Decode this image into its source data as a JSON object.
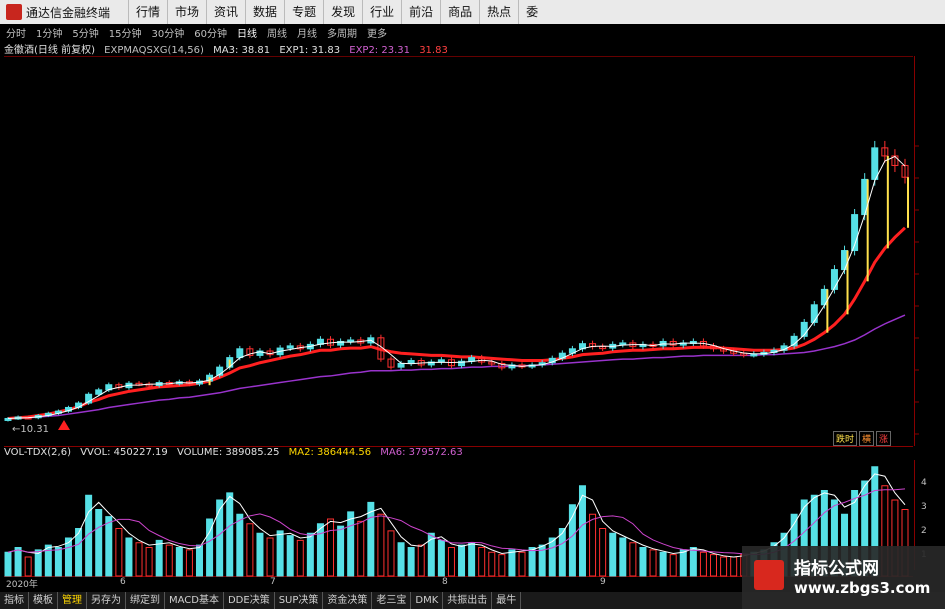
{
  "app": {
    "title": "通达信金融终端",
    "menu": [
      "行情",
      "市场",
      "资讯",
      "数据",
      "专题",
      "发现",
      "行业",
      "前沿",
      "商品",
      "热点",
      "委"
    ]
  },
  "period_tabs": [
    "分时",
    "1分钟",
    "5分钟",
    "15分钟",
    "30分钟",
    "60分钟",
    "日线",
    "周线",
    "月线",
    "多周期",
    "更多"
  ],
  "active_period": "日线",
  "stock": {
    "name": "金徽酒(日线 前复权)",
    "indicator_name": "EXPMAQSXG(14,56)",
    "ma3": "MA3: 38.81",
    "exp1": "EXP1: 31.83",
    "exp2": "EXP2: 23.31",
    "exp3": "31.83"
  },
  "low_marker": "10.31",
  "volume": {
    "indicator": "VOL-TDX(2,6)",
    "vvol": "VVOL: 450227.19",
    "volume": "VOLUME: 389085.25",
    "ma2": "MA2: 386444.56",
    "ma6": "MA6: 379572.63"
  },
  "vol_axis_ticks": [
    "4",
    "3",
    "2",
    "1"
  ],
  "xaxis": {
    "year": "2020年",
    "months": [
      "6",
      "7",
      "8",
      "9"
    ]
  },
  "legend": [
    "跌时",
    "横",
    "涨"
  ],
  "bottom_tabs": [
    "指标",
    "模板",
    "管理",
    "另存为",
    "绑定到",
    "MACD基本",
    "DDE决策",
    "SUP决策",
    "资金决策",
    "老三宝",
    "DMK",
    "共振出击",
    "最牛"
  ],
  "active_bottom_tab": "管理",
  "watermark": {
    "title": "指标公式网",
    "url": "www.zbgs3.com"
  },
  "colors": {
    "up": "#56e0e6",
    "down": "#ff3030",
    "ma": "#ffffff",
    "exp1": "#ff2020",
    "exp2": "#9933cc",
    "signal": "#ffe14d"
  },
  "chart_data": {
    "type": "candlestick",
    "price_series": {
      "close": [
        10.3,
        10.5,
        10.4,
        10.7,
        11.0,
        11.3,
        11.8,
        12.4,
        13.6,
        14.2,
        14.9,
        14.5,
        15.1,
        15.0,
        14.8,
        15.2,
        15.1,
        15.3,
        15.0,
        15.4,
        16.2,
        17.3,
        18.6,
        19.8,
        18.9,
        19.5,
        19.0,
        19.9,
        20.2,
        19.8,
        20.4,
        21.1,
        20.3,
        20.8,
        21.0,
        20.6,
        21.3,
        18.4,
        17.3,
        17.8,
        18.2,
        17.6,
        18.0,
        18.3,
        17.5,
        18.1,
        18.6,
        18.0,
        17.8,
        17.2,
        17.6,
        17.4,
        17.6,
        17.9,
        18.5,
        19.2,
        19.8,
        20.5,
        20.1,
        19.9,
        20.4,
        20.6,
        20.1,
        20.4,
        20.2,
        20.8,
        20.3,
        20.6,
        20.8,
        20.2,
        19.8,
        19.5,
        19.2,
        19.0,
        19.1,
        19.3,
        19.6,
        20.2,
        21.5,
        23.4,
        25.8,
        27.9,
        30.6,
        33.2,
        38.1,
        42.9,
        47.2,
        46.1,
        44.8,
        43.2
      ],
      "exp1": [
        10.3,
        10.4,
        10.5,
        10.7,
        10.9,
        11.2,
        11.5,
        11.9,
        12.5,
        12.9,
        13.4,
        13.7,
        14.0,
        14.2,
        14.4,
        14.6,
        14.7,
        14.8,
        14.9,
        15.1,
        15.4,
        15.9,
        16.5,
        17.2,
        17.5,
        17.9,
        18.2,
        18.5,
        18.8,
        19.0,
        19.3,
        19.6,
        19.6,
        19.8,
        19.9,
        19.9,
        20.1,
        19.7,
        19.4,
        19.2,
        19.1,
        19.0,
        18.9,
        18.9,
        18.8,
        18.7,
        18.7,
        18.6,
        18.5,
        18.4,
        18.3,
        18.2,
        18.2,
        18.2,
        18.3,
        18.5,
        18.7,
        19.0,
        19.1,
        19.2,
        19.4,
        19.5,
        19.6,
        19.6,
        19.7,
        19.8,
        19.8,
        19.9,
        20.0,
        20.0,
        20.0,
        19.9,
        19.8,
        19.7,
        19.6,
        19.6,
        19.6,
        19.7,
        19.9,
        20.4,
        21.1,
        22.0,
        23.1,
        24.5,
        26.6,
        29.0,
        31.6,
        33.5,
        35.0,
        36.3
      ],
      "exp2": [
        10.3,
        10.35,
        10.4,
        10.5,
        10.6,
        10.7,
        10.9,
        11.1,
        11.3,
        11.5,
        11.8,
        12.0,
        12.2,
        12.4,
        12.6,
        12.8,
        12.9,
        13.1,
        13.2,
        13.4,
        13.6,
        13.8,
        14.1,
        14.4,
        14.6,
        14.8,
        15.0,
        15.2,
        15.4,
        15.6,
        15.8,
        16.0,
        16.1,
        16.3,
        16.5,
        16.6,
        16.8,
        16.8,
        16.8,
        16.9,
        16.9,
        17.0,
        17.0,
        17.1,
        17.1,
        17.2,
        17.3,
        17.3,
        17.4,
        17.4,
        17.4,
        17.5,
        17.5,
        17.6,
        17.7,
        17.8,
        17.9,
        18.0,
        18.1,
        18.2,
        18.3,
        18.4,
        18.4,
        18.5,
        18.6,
        18.6,
        18.7,
        18.8,
        18.8,
        18.9,
        18.9,
        18.9,
        18.9,
        18.9,
        18.9,
        19.0,
        19.0,
        19.1,
        19.2,
        19.3,
        19.5,
        19.8,
        20.1,
        20.5,
        21.0,
        21.7,
        22.5,
        23.2,
        23.8,
        24.4
      ]
    },
    "volume_series": [
      1.0,
      1.2,
      0.8,
      1.1,
      1.3,
      1.2,
      1.6,
      2.0,
      3.4,
      2.8,
      2.5,
      2.0,
      1.6,
      1.4,
      1.2,
      1.5,
      1.3,
      1.2,
      1.1,
      1.3,
      2.4,
      3.2,
      3.5,
      2.6,
      2.2,
      1.8,
      1.6,
      1.9,
      1.7,
      1.5,
      1.8,
      2.2,
      2.4,
      2.1,
      2.7,
      2.3,
      3.1,
      2.6,
      1.9,
      1.4,
      1.2,
      1.3,
      1.8,
      1.5,
      1.2,
      1.3,
      1.4,
      1.2,
      1.0,
      0.9,
      1.1,
      1.0,
      1.2,
      1.3,
      1.6,
      2.0,
      3.0,
      3.8,
      2.6,
      2.0,
      1.8,
      1.6,
      1.4,
      1.2,
      1.1,
      1.0,
      0.9,
      1.1,
      1.2,
      1.0,
      0.9,
      0.8,
      0.8,
      0.9,
      1.0,
      1.1,
      1.4,
      1.8,
      2.6,
      3.2,
      3.4,
      3.6,
      3.2,
      2.6,
      3.6,
      4.0,
      4.6,
      3.8,
      3.2,
      2.8
    ]
  }
}
